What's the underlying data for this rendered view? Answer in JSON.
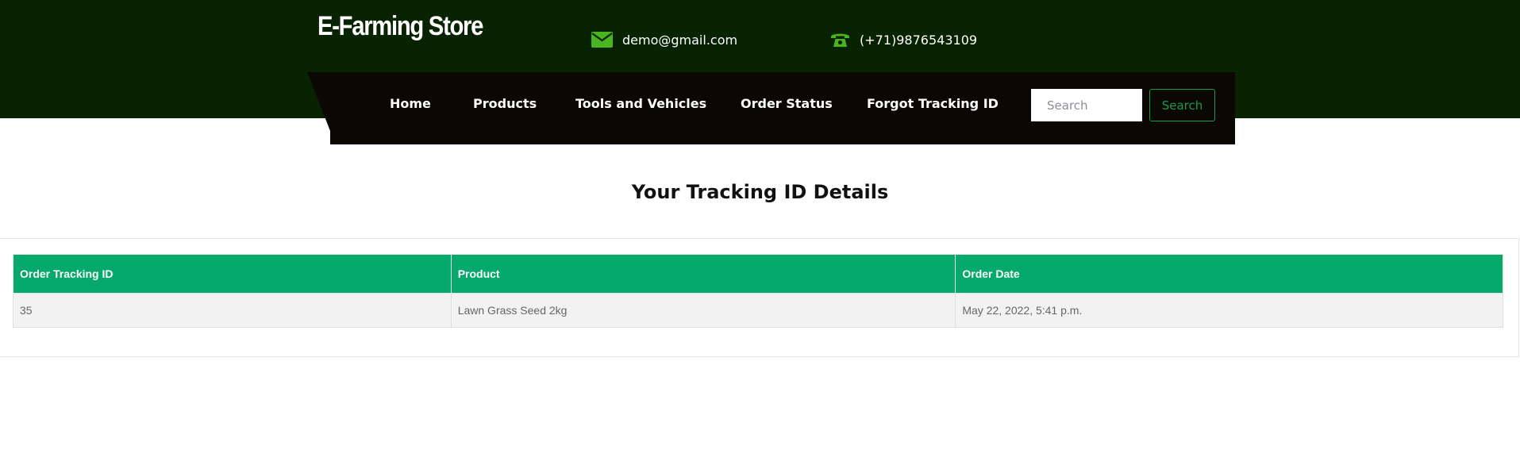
{
  "header": {
    "brand": "E-Farming Store",
    "email": "demo@gmail.com",
    "phone": "(+71)9876543109",
    "email_icon": "envelope-icon",
    "phone_icon": "phone-icon",
    "accent_color": "#4bb520",
    "background_color": "#072302"
  },
  "nav": {
    "items": [
      {
        "label": "Home"
      },
      {
        "label": "Products"
      },
      {
        "label": "Tools and Vehicles"
      },
      {
        "label": "Order Status"
      },
      {
        "label": "Forgot Tracking ID"
      }
    ],
    "search_placeholder": "Search",
    "search_button": "Search",
    "background_color": "#0b0804"
  },
  "main": {
    "title": "Your Tracking ID Details",
    "table": {
      "header_color": "#05a96b",
      "columns": [
        "Order Tracking ID",
        "Product",
        "Order Date"
      ],
      "rows": [
        [
          "35",
          "Lawn Grass Seed 2kg",
          "May 22, 2022, 5:41 p.m."
        ]
      ]
    }
  }
}
